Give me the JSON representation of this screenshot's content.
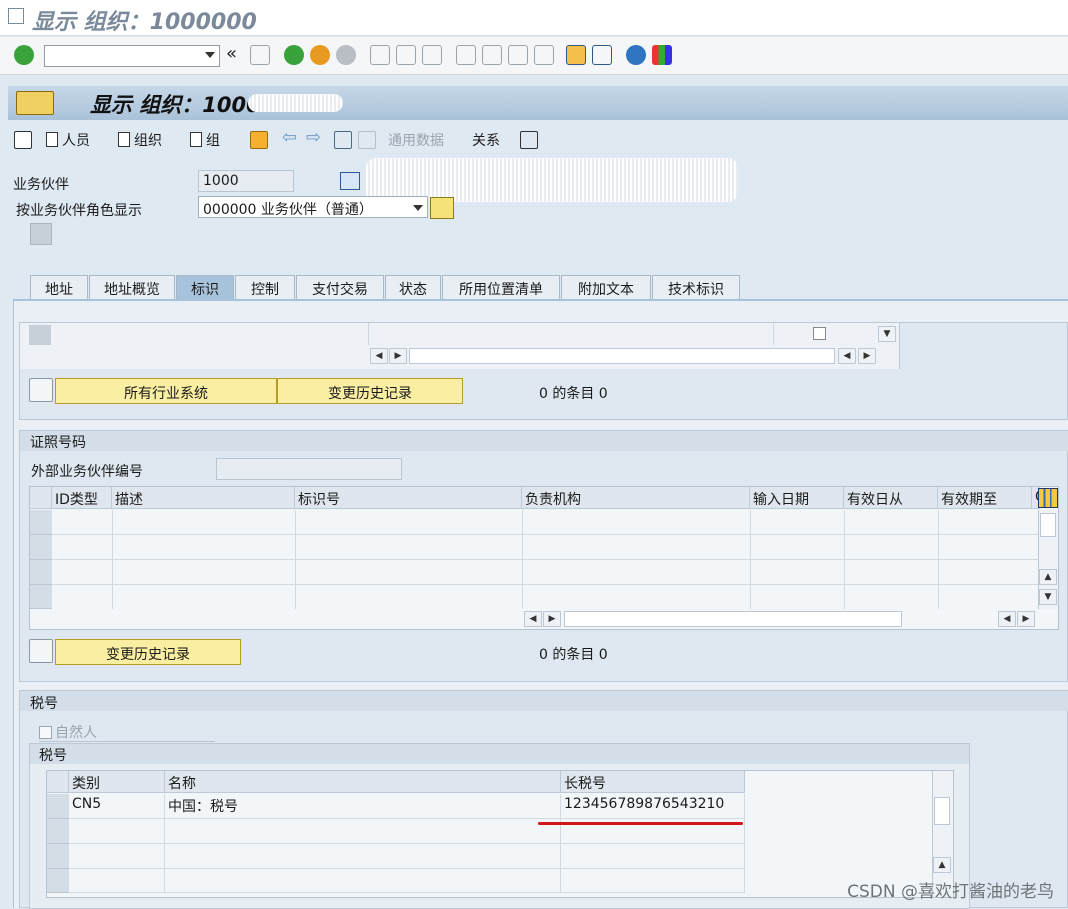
{
  "window": {
    "title": "显示 组织：1000000"
  },
  "command_field": {
    "value": ""
  },
  "header": {
    "title": "显示 组织：1000"
  },
  "app_toolbar": {
    "person": "人员",
    "org": "组织",
    "group": "组",
    "general_data": "通用数据",
    "relations": "关系"
  },
  "fields": {
    "partner_label": "业务伙伴",
    "partner_value": "1000",
    "role_label": "按业务伙伴角色显示",
    "role_value": "000000 业务伙伴（普通）"
  },
  "tabs": [
    {
      "label": "地址"
    },
    {
      "label": "地址概览"
    },
    {
      "label": "标识",
      "active": true
    },
    {
      "label": "控制"
    },
    {
      "label": "支付交易"
    },
    {
      "label": "状态"
    },
    {
      "label": "所用位置清单"
    },
    {
      "label": "附加文本"
    },
    {
      "label": "技术标识"
    }
  ],
  "industry": {
    "btn_all": "所有行业系统",
    "btn_history": "变更历史记录",
    "count": "0 的条目 0"
  },
  "id_numbers": {
    "title": "证照号码",
    "ext_label": "外部业务伙伴编号",
    "ext_value": "",
    "columns": [
      "ID类型",
      "描述",
      "标识号",
      "负责机构",
      "输入日期",
      "有效日从",
      "有效期至",
      "C"
    ],
    "btn_history": "变更历史记录",
    "count": "0 的条目 0"
  },
  "tax": {
    "title": "税号",
    "natural_person": "自然人",
    "sub_title": "税号",
    "columns": [
      "类别",
      "名称",
      "长税号"
    ],
    "rows": [
      {
        "category": "CN5",
        "name": "中国：税号",
        "long_number": "123456789876543210"
      }
    ]
  },
  "watermark": "CSDN @喜欢打酱油的老鸟",
  "colors": {
    "accent": "#a7c2db",
    "yellow_button": "#faeea2",
    "highlight_line": "#d01818"
  }
}
